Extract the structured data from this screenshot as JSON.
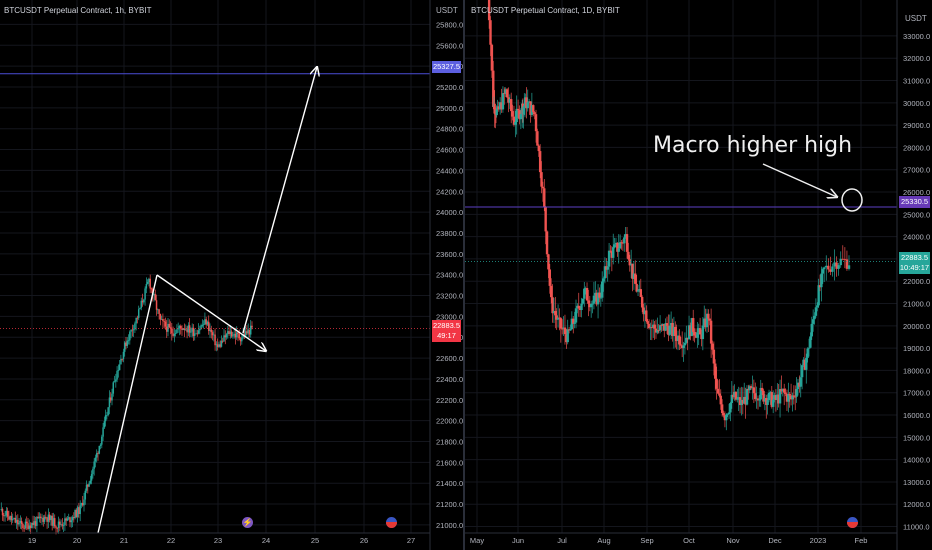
{
  "left_chart": {
    "title": "BTCUSDT Perpetual Contract, 1h, BYBIT",
    "unit": "USDT",
    "price_label": "25327.5",
    "last_price": "22883.5",
    "countdown": "49:17",
    "colors": {
      "up": "#26a69a",
      "down": "#ef5350",
      "level": "#4a4dd6",
      "last": "#f23645",
      "arrow": "#ffffff"
    }
  },
  "right_chart": {
    "title": "BTCUSDT Perpetual Contract, 1D, BYBIT",
    "unit": "USDT",
    "level_label": "25330.5",
    "last_price": "22883.5",
    "countdown": "10:49:17",
    "annotation": "Macro higher high",
    "colors": {
      "up": "#26a69a",
      "down": "#ef5350",
      "level": "#5b3fc4",
      "last": "#26a69a"
    }
  },
  "chart_data": [
    {
      "type": "line",
      "title": "BTCUSDT Perpetual Contract, 1h, BYBIT",
      "xlabel": "",
      "ylabel": "",
      "x_ticks": [
        "19",
        "20",
        "21",
        "22",
        "23",
        "24",
        "25",
        "26",
        "27"
      ],
      "y_ticks": [
        "21000.0",
        "21200.0",
        "21400.0",
        "21600.0",
        "21800.0",
        "22000.0",
        "22200.0",
        "22400.0",
        "22600.0",
        "22800.0",
        "23000.0",
        "23200.0",
        "23400.0",
        "23600.0",
        "23800.0",
        "24000.0",
        "24200.0",
        "24400.0",
        "24600.0",
        "24800.0",
        "25000.0",
        "25200.0",
        "25400.0",
        "25600.0",
        "25800.0"
      ],
      "ylim": [
        20980,
        25900
      ],
      "grid": true,
      "series": [
        {
          "x": [
            19.0,
            19.2,
            19.4,
            19.6,
            19.8,
            20.0,
            20.2,
            20.4,
            20.6,
            20.8,
            21.0,
            21.2,
            21.4,
            21.6,
            21.8,
            22.0,
            22.2,
            22.4,
            22.6,
            22.8,
            23.0,
            23.2,
            23.4
          ],
          "values": [
            21150,
            21050,
            20990,
            21020,
            21080,
            21000,
            21050,
            21150,
            21500,
            21900,
            22400,
            22750,
            23000,
            23350,
            22950,
            22850,
            22900,
            22850,
            22950,
            22700,
            22850,
            22800,
            22880
          ]
        }
      ],
      "horizontal_levels": [
        25327.5,
        22883.5
      ]
    },
    {
      "type": "line",
      "title": "BTCUSDT Perpetual Contract, 1D, BYBIT",
      "xlabel": "",
      "ylabel": "",
      "x_ticks": [
        "May",
        "Jun",
        "Jul",
        "Aug",
        "Sep",
        "Oct",
        "Nov",
        "Dec",
        "2023",
        "Feb"
      ],
      "y_ticks": [
        "11000.0",
        "12000.0",
        "13000.0",
        "14000.0",
        "15000.0",
        "16000.0",
        "17000.0",
        "18000.0",
        "19000.0",
        "20000.0",
        "21000.0",
        "22000.0",
        "23000.0",
        "24000.0",
        "25000.0",
        "26000.0",
        "27000.0",
        "28000.0",
        "29000.0",
        "30000.0",
        "31000.0",
        "32000.0",
        "33000.0"
      ],
      "ylim": [
        10800,
        33400
      ],
      "grid": true,
      "series": [
        {
          "x": [
            0.0,
            0.2,
            0.3,
            0.5,
            0.7,
            0.9,
            1.0,
            1.2,
            1.4,
            1.6,
            1.8,
            2.0,
            2.2,
            2.4,
            2.6,
            2.8,
            3.0,
            3.2,
            3.4,
            3.6,
            3.8,
            4.0,
            4.2,
            4.4,
            4.6,
            4.8,
            5.0,
            5.2,
            5.4,
            5.6,
            5.8,
            6.0,
            6.2,
            6.4,
            6.6,
            6.8,
            7.0,
            7.2,
            7.4,
            7.6,
            7.8,
            8.0,
            8.2,
            8.5,
            8.8
          ],
          "values": [
            38000,
            30000,
            29500,
            30500,
            29200,
            29800,
            30000,
            29500,
            26000,
            21000,
            20000,
            19500,
            20500,
            21500,
            21000,
            21500,
            23200,
            23500,
            24000,
            22000,
            21000,
            20000,
            19800,
            20000,
            19600,
            19300,
            20000,
            19500,
            20500,
            17000,
            16000,
            16800,
            16500,
            17000,
            17000,
            16800,
            16600,
            17000,
            16700,
            17500,
            18800,
            21000,
            22500,
            22900,
            22883
          ]
        }
      ],
      "horizontal_levels": [
        25330.5,
        22883.5
      ],
      "annotations": [
        "Macro higher high"
      ]
    }
  ]
}
